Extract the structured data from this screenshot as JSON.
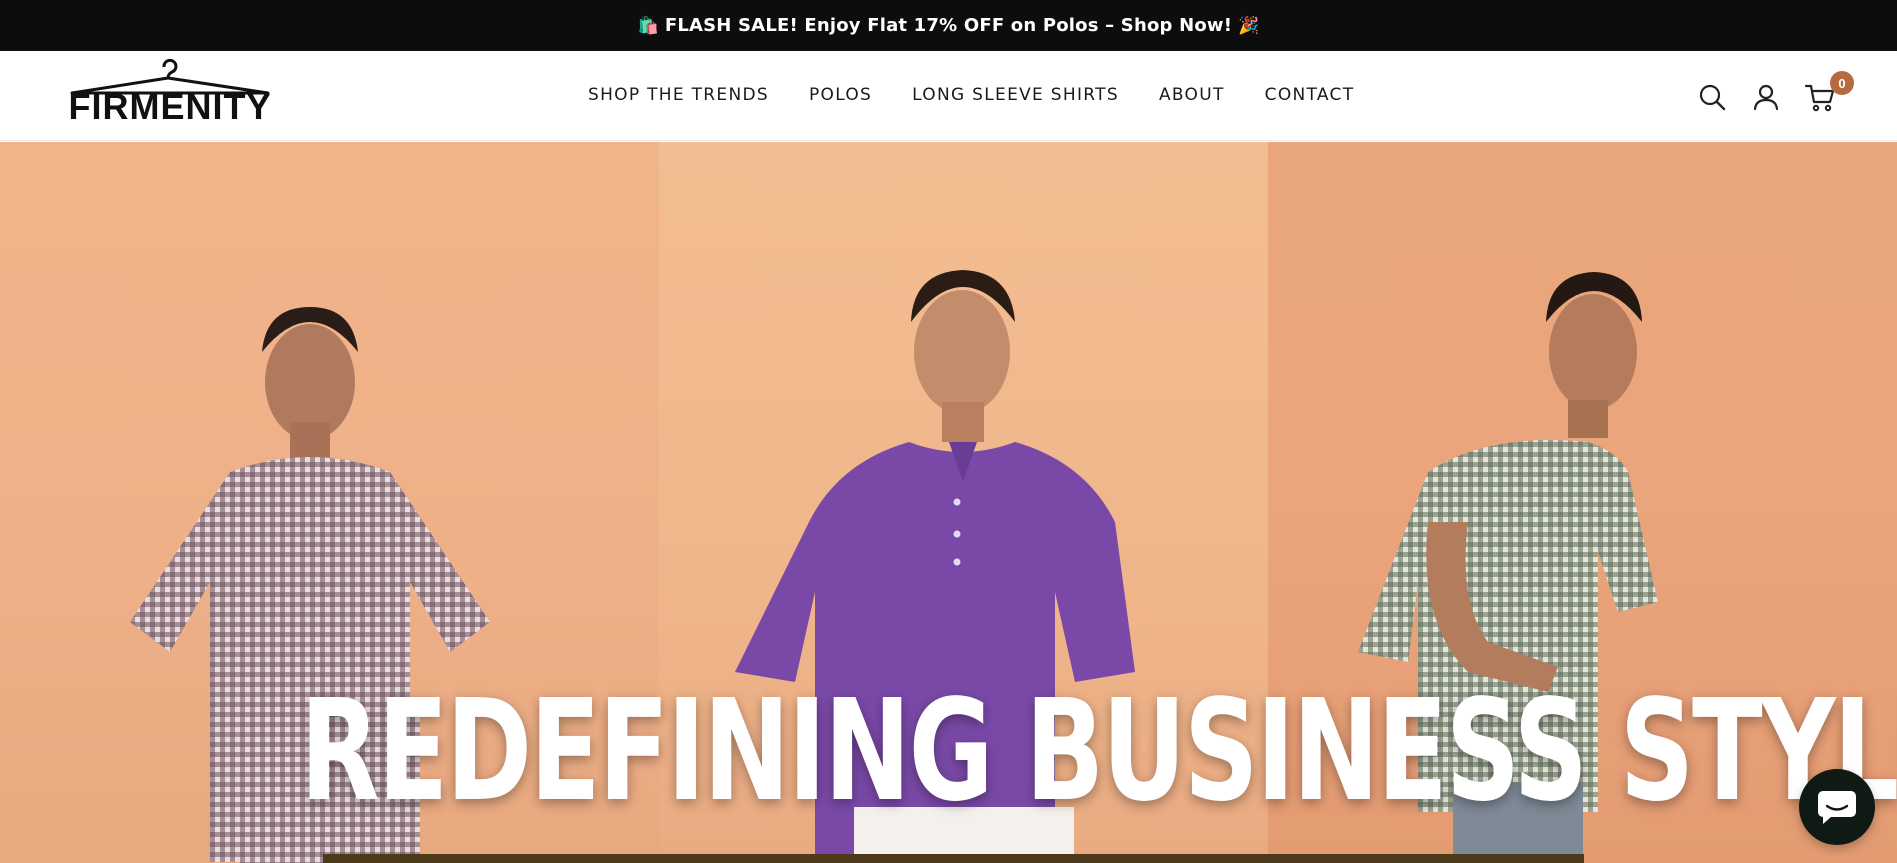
{
  "announcement": {
    "emoji_left": "🛍️",
    "text": "FLASH SALE! Enjoy Flat 17% OFF on Polos – Shop Now!",
    "emoji_right": "🎉"
  },
  "brand": {
    "name": "FIRMENITY"
  },
  "nav": {
    "items": [
      {
        "label": "SHOP THE TRENDS"
      },
      {
        "label": "POLOS"
      },
      {
        "label": "LONG SLEEVE SHIRTS"
      },
      {
        "label": "ABOUT"
      },
      {
        "label": "CONTACT"
      }
    ]
  },
  "header_icons": {
    "search": "search-icon",
    "account": "account-icon",
    "cart": "cart-icon",
    "cart_count": "0"
  },
  "hero": {
    "title": "REDEFINING BUSINESS STYLE",
    "panels": [
      "model-checked-shirt",
      "model-purple-polo",
      "model-green-check-shirt"
    ]
  },
  "chat": {
    "icon": "chat-icon"
  },
  "colors": {
    "announcement_bg": "#0d0d0d",
    "cart_badge": "#b66a3f",
    "hero_bg": "#efb389",
    "chat_bg": "#0f1a14"
  }
}
